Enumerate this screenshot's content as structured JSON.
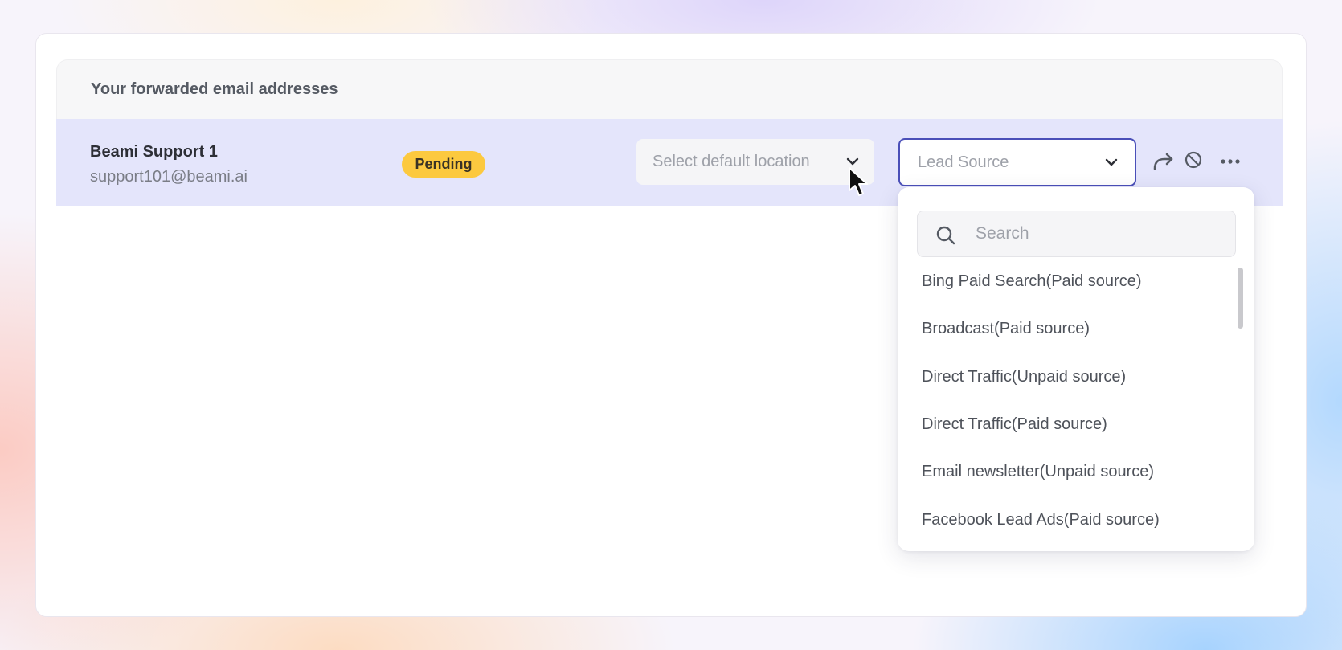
{
  "section": {
    "title": "Your forwarded email addresses"
  },
  "row": {
    "name": "Beami Support 1",
    "email": "support101@beami.ai",
    "status": "Pending",
    "status_color": "#fcc93f",
    "location_select": {
      "placeholder": "Select default location",
      "icon": "chevron-down-icon"
    },
    "lead_source_select": {
      "placeholder": "Lead Source",
      "icon": "chevron-down-icon",
      "focus_color": "#4a4fb8"
    },
    "actions": {
      "forward_icon": "forward-icon",
      "block_icon": "block-icon",
      "more_icon": "more-icon"
    },
    "highlight_color": "#e4e5fb"
  },
  "dropdown": {
    "search_placeholder": "Search",
    "options": [
      "Bing Paid Search(Paid source)",
      "Broadcast(Paid source)",
      "Direct Traffic(Unpaid source)",
      "Direct Traffic(Paid source)",
      "Email newsletter(Unpaid source)",
      "Facebook Lead Ads(Paid source)"
    ]
  }
}
